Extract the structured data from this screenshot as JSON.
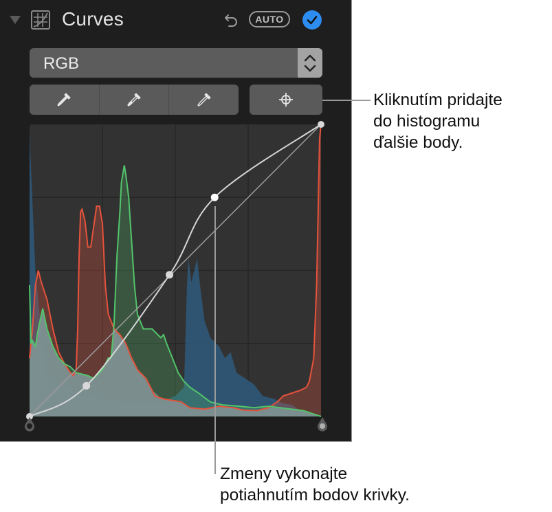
{
  "panel": {
    "title": "Curves",
    "auto_label": "AUTO",
    "enabled": true,
    "accent_color": "#2d8cf0",
    "channel_select": {
      "selected": "RGB"
    },
    "eyedroppers": [
      {
        "name": "black-point-eyedropper",
        "fill": "solid"
      },
      {
        "name": "gray-point-eyedropper",
        "fill": "half"
      },
      {
        "name": "white-point-eyedropper",
        "fill": "outline"
      }
    ],
    "add_point_tool": "crosshair"
  },
  "histogram": {
    "grid_divisions": 4,
    "colors": {
      "red": "#e5533c",
      "green": "#52c46a",
      "blue": "#2f5a7c",
      "luminance": "#7e9295"
    },
    "blue_area": [
      [
        0,
        0.98
      ],
      [
        0.005,
        0.85
      ],
      [
        0.02,
        0.5
      ],
      [
        0.035,
        0.35
      ],
      [
        0.05,
        0.15
      ],
      [
        0.07,
        0.12
      ],
      [
        0.09,
        0.11
      ],
      [
        0.12,
        0.1
      ],
      [
        0.16,
        0.08
      ],
      [
        0.2,
        0.07
      ],
      [
        0.3,
        0.05
      ],
      [
        0.45,
        0.05
      ],
      [
        0.5,
        0.07
      ],
      [
        0.53,
        0.1
      ],
      [
        0.54,
        0.45
      ],
      [
        0.545,
        0.54
      ],
      [
        0.555,
        0.46
      ],
      [
        0.565,
        0.5
      ],
      [
        0.575,
        0.54
      ],
      [
        0.585,
        0.45
      ],
      [
        0.6,
        0.33
      ],
      [
        0.62,
        0.27
      ],
      [
        0.65,
        0.24
      ],
      [
        0.67,
        0.2
      ],
      [
        0.69,
        0.22
      ],
      [
        0.71,
        0.15
      ],
      [
        0.74,
        0.13
      ],
      [
        0.77,
        0.11
      ],
      [
        0.8,
        0.07
      ],
      [
        0.84,
        0.06
      ],
      [
        0.87,
        0.045
      ],
      [
        0.9,
        0.04
      ],
      [
        0.93,
        0.02
      ],
      [
        1,
        0
      ]
    ],
    "red_line": [
      [
        0,
        0.2
      ],
      [
        0.01,
        0.3
      ],
      [
        0.02,
        0.45
      ],
      [
        0.03,
        0.5
      ],
      [
        0.04,
        0.46
      ],
      [
        0.06,
        0.4
      ],
      [
        0.08,
        0.3
      ],
      [
        0.1,
        0.22
      ],
      [
        0.12,
        0.18
      ],
      [
        0.14,
        0.15
      ],
      [
        0.15,
        0.14
      ],
      [
        0.16,
        0.16
      ],
      [
        0.165,
        0.3
      ],
      [
        0.17,
        0.55
      ],
      [
        0.175,
        0.7
      ],
      [
        0.18,
        0.71
      ],
      [
        0.19,
        0.67
      ],
      [
        0.2,
        0.58
      ],
      [
        0.21,
        0.58
      ],
      [
        0.22,
        0.65
      ],
      [
        0.23,
        0.72
      ],
      [
        0.24,
        0.72
      ],
      [
        0.25,
        0.66
      ],
      [
        0.26,
        0.45
      ],
      [
        0.27,
        0.35
      ],
      [
        0.29,
        0.3
      ],
      [
        0.31,
        0.28
      ],
      [
        0.33,
        0.25
      ],
      [
        0.35,
        0.2
      ],
      [
        0.37,
        0.16
      ],
      [
        0.4,
        0.13
      ],
      [
        0.43,
        0.07
      ],
      [
        0.46,
        0.06
      ],
      [
        0.49,
        0.055
      ],
      [
        0.52,
        0.05
      ],
      [
        0.55,
        0.03
      ],
      [
        0.6,
        0.025
      ],
      [
        0.65,
        0.035
      ],
      [
        0.7,
        0.03
      ],
      [
        0.73,
        0.022
      ],
      [
        0.78,
        0.02
      ],
      [
        0.82,
        0.03
      ],
      [
        0.85,
        0.05
      ],
      [
        0.87,
        0.07
      ],
      [
        0.9,
        0.08
      ],
      [
        0.93,
        0.09
      ],
      [
        0.95,
        0.1
      ],
      [
        0.96,
        0.12
      ],
      [
        0.975,
        0.2
      ],
      [
        0.985,
        0.45
      ],
      [
        0.99,
        0.7
      ],
      [
        0.995,
        0.95
      ],
      [
        1,
        1
      ]
    ],
    "green_line": [
      [
        0,
        0.45
      ],
      [
        0.005,
        0.25
      ],
      [
        0.01,
        0.26
      ],
      [
        0.02,
        0.24
      ],
      [
        0.03,
        0.3
      ],
      [
        0.045,
        0.37
      ],
      [
        0.06,
        0.3
      ],
      [
        0.08,
        0.24
      ],
      [
        0.1,
        0.2
      ],
      [
        0.12,
        0.18
      ],
      [
        0.14,
        0.17
      ],
      [
        0.16,
        0.15
      ],
      [
        0.2,
        0.14
      ],
      [
        0.22,
        0.13
      ],
      [
        0.25,
        0.16
      ],
      [
        0.27,
        0.2
      ],
      [
        0.28,
        0.2
      ],
      [
        0.29,
        0.32
      ],
      [
        0.3,
        0.55
      ],
      [
        0.31,
        0.7
      ],
      [
        0.315,
        0.8
      ],
      [
        0.325,
        0.86
      ],
      [
        0.33,
        0.83
      ],
      [
        0.34,
        0.75
      ],
      [
        0.35,
        0.6
      ],
      [
        0.36,
        0.45
      ],
      [
        0.37,
        0.35
      ],
      [
        0.39,
        0.3
      ],
      [
        0.42,
        0.3
      ],
      [
        0.45,
        0.27
      ],
      [
        0.46,
        0.28
      ],
      [
        0.47,
        0.25
      ],
      [
        0.49,
        0.2
      ],
      [
        0.51,
        0.15
      ],
      [
        0.53,
        0.12
      ],
      [
        0.55,
        0.1
      ],
      [
        0.58,
        0.08
      ],
      [
        0.62,
        0.05
      ],
      [
        0.66,
        0.04
      ],
      [
        0.72,
        0.035
      ],
      [
        0.77,
        0.03
      ],
      [
        0.82,
        0.035
      ],
      [
        0.86,
        0.03
      ],
      [
        0.9,
        0.025
      ],
      [
        0.94,
        0.02
      ],
      [
        0.97,
        0.01
      ],
      [
        1,
        0
      ]
    ],
    "curve_points": [
      [
        0,
        0
      ],
      [
        0.195,
        0.105
      ],
      [
        0.48,
        0.485
      ],
      [
        0.635,
        0.75
      ],
      [
        1,
        1
      ]
    ],
    "diagonal": [
      [
        0,
        0
      ],
      [
        1,
        1
      ]
    ]
  },
  "callouts": [
    {
      "name": "add-point-callout",
      "lines": [
        "Kliknutím pridajte",
        "do histogramu",
        "ďalšie body."
      ]
    },
    {
      "name": "drag-points-callout",
      "lines": [
        "Zmeny vykonajte",
        "potiahnutím bodov krivky."
      ]
    }
  ]
}
